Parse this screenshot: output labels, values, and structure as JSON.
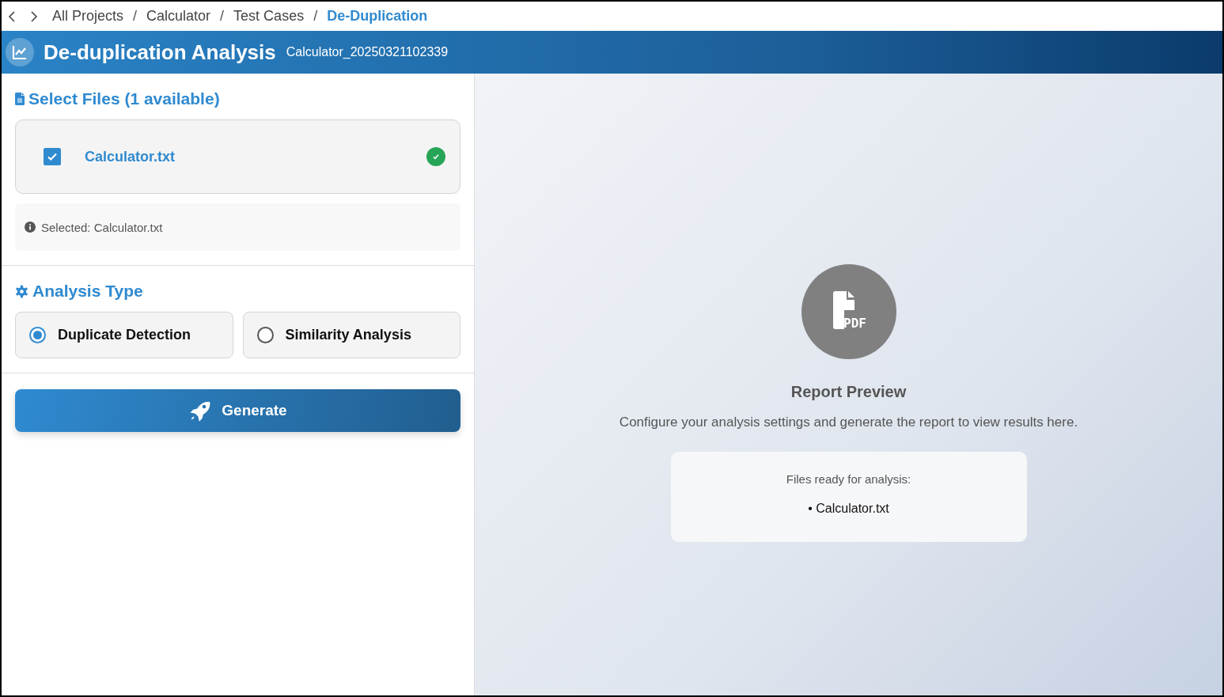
{
  "breadcrumb": {
    "items": [
      {
        "label": "All Projects",
        "current": false
      },
      {
        "label": "Calculator",
        "current": false
      },
      {
        "label": "Test Cases",
        "current": false
      },
      {
        "label": "De-Duplication",
        "current": true
      }
    ],
    "separator": "/"
  },
  "header": {
    "title": "De-duplication Analysis",
    "subtitle": "Calculator_20250321102339"
  },
  "files": {
    "title": "Select Files (1 available)",
    "items": [
      {
        "name": "Calculator.txt",
        "checked": true,
        "valid": true
      }
    ],
    "selected_note": "Selected: Calculator.txt"
  },
  "analysis": {
    "title": "Analysis Type",
    "options": [
      {
        "label": "Duplicate Detection",
        "selected": true
      },
      {
        "label": "Similarity Analysis",
        "selected": false
      }
    ]
  },
  "generate_button": "Generate",
  "preview": {
    "icon_label": "PDF",
    "title": "Report Preview",
    "description": "Configure your analysis settings and generate the report to view results here.",
    "files_title": "Files ready for analysis:",
    "files": [
      "• Calculator.txt"
    ]
  }
}
